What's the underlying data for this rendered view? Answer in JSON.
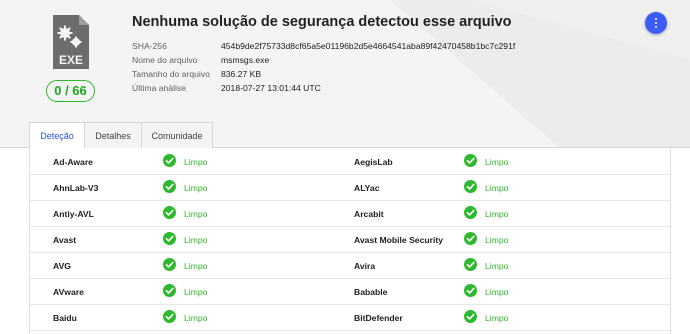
{
  "file": {
    "icon": "exe-file-icon",
    "icon_label": "EXE",
    "score": "0 / 66",
    "title": "Nenhuma solução de segurança detectou esse arquivo",
    "meta": [
      {
        "label": "SHA-256",
        "value": "454b9de2f75733d8cf65a5e01196b2d5e4664541aba89f42470458b1bc7c291f"
      },
      {
        "label": "Nome do arquivo",
        "value": "msmsgs.exe"
      },
      {
        "label": "Tamanho do arquivo",
        "value": "836.27 KB"
      },
      {
        "label": "Última análise",
        "value": "2018-07-27 13:01:44 UTC"
      }
    ]
  },
  "fab_icon": "more-vertical-icon",
  "tabs": [
    "Deteção",
    "Detalhes",
    "Comunidade"
  ],
  "active_tab": 0,
  "results": [
    [
      {
        "engine": "Ad-Aware",
        "result": "Limpo"
      },
      {
        "engine": "AegisLab",
        "result": "Limpo"
      }
    ],
    [
      {
        "engine": "AhnLab-V3",
        "result": "Limpo"
      },
      {
        "engine": "ALYac",
        "result": "Limpo"
      }
    ],
    [
      {
        "engine": "Antiy-AVL",
        "result": "Limpo"
      },
      {
        "engine": "Arcabit",
        "result": "Limpo"
      }
    ],
    [
      {
        "engine": "Avast",
        "result": "Limpo"
      },
      {
        "engine": "Avast Mobile Security",
        "result": "Limpo"
      }
    ],
    [
      {
        "engine": "AVG",
        "result": "Limpo"
      },
      {
        "engine": "Avira",
        "result": "Limpo"
      }
    ],
    [
      {
        "engine": "AVware",
        "result": "Limpo"
      },
      {
        "engine": "Babable",
        "result": "Limpo"
      }
    ],
    [
      {
        "engine": "Baidu",
        "result": "Limpo"
      },
      {
        "engine": "BitDefender",
        "result": "Limpo"
      }
    ]
  ],
  "colors": {
    "clean": "#2eb82e",
    "accent": "#3c5cf5",
    "tab_active": "#2a58d8"
  }
}
